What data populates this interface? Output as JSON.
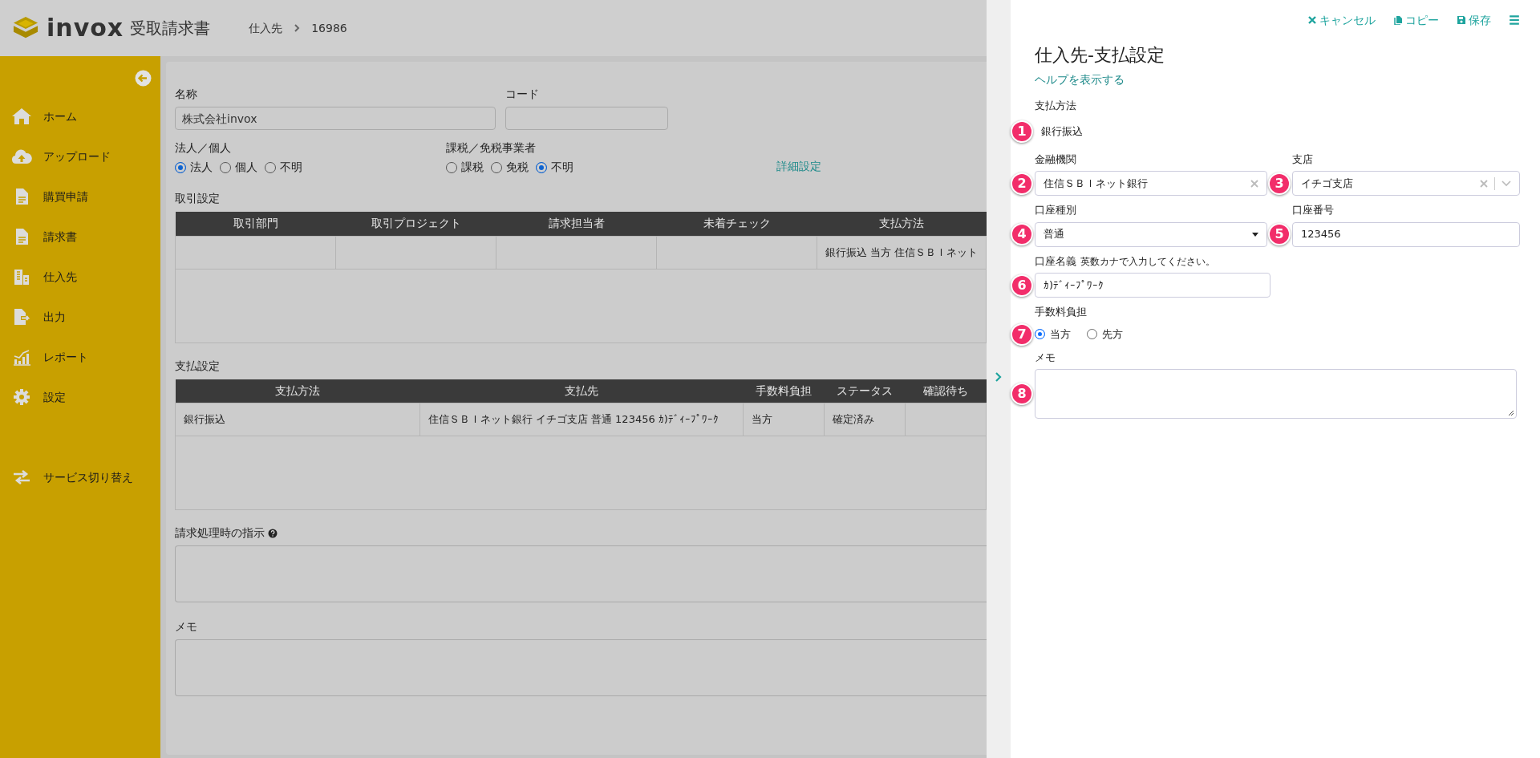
{
  "header": {
    "logo": "invox",
    "product": "受取請求書",
    "breadcrumb": [
      "仕入先",
      "16986"
    ]
  },
  "sidebar": {
    "items": [
      {
        "label": "ホーム",
        "kind": "home"
      },
      {
        "label": "アップロード",
        "kind": "upload"
      },
      {
        "label": "購買申請",
        "kind": "document"
      },
      {
        "label": "請求書",
        "kind": "document"
      },
      {
        "label": "仕入先",
        "kind": "building"
      },
      {
        "label": "出力",
        "kind": "export"
      },
      {
        "label": "レポート",
        "kind": "chart"
      },
      {
        "label": "設定",
        "kind": "gear"
      }
    ],
    "footer_items": [
      {
        "label": "サービス切り替え",
        "kind": "switch"
      }
    ]
  },
  "form": {
    "name": {
      "label": "名称",
      "value": "株式会社invox"
    },
    "code": {
      "label": "コード"
    },
    "entity": {
      "label": "法人／個人",
      "options": [
        {
          "label": "法人",
          "selected": true
        },
        {
          "label": "個人",
          "selected": false
        },
        {
          "label": "不明",
          "selected": false
        }
      ]
    },
    "tax": {
      "label": "課税／免税事業者",
      "options": [
        {
          "label": "課税",
          "selected": false
        },
        {
          "label": "免税",
          "selected": false
        },
        {
          "label": "不明",
          "selected": true
        }
      ]
    },
    "detail_link": "詳細設定",
    "trade_table": {
      "title": "取引設定",
      "columns": [
        "取引部門",
        "取引プロジェクト",
        "請求担当者",
        "未着チェック",
        "支払方法"
      ],
      "rows": [
        [
          "",
          "",
          "",
          "",
          "銀行振込 当方 住信ＳＢＩネット"
        ]
      ]
    },
    "payment_table": {
      "title": "支払設定",
      "columns": [
        "支払方法",
        "支払先",
        "手数料負担",
        "ステータス",
        "確認待ち"
      ],
      "rows": [
        [
          "銀行振込",
          "住信ＳＢＩネット銀行 イチゴ支店 普通 123456 ｶ)ﾃﾞｨｰﾌﾟﾜｰｸ",
          "当方",
          "確定済み",
          ""
        ]
      ]
    },
    "instructions": {
      "label": "請求処理時の指示"
    },
    "memo": {
      "label": "メモ"
    }
  },
  "panel": {
    "toolbar": [
      {
        "label": "キャンセル",
        "kind": "cancel"
      },
      {
        "label": "コピー",
        "kind": "copy"
      },
      {
        "label": "保存",
        "kind": "save"
      },
      {
        "kind": "menu"
      }
    ],
    "title": "仕入先-支払設定",
    "help_link": "ヘルプを表示する",
    "method": {
      "label": "支払方法",
      "value": "銀行振込",
      "marker": "1"
    },
    "bank": {
      "label": "金融機関",
      "value": "住信ＳＢＩネット銀行",
      "marker": "2"
    },
    "branch": {
      "label": "支店",
      "value": "イチゴ支店",
      "marker": "3"
    },
    "account_type": {
      "label": "口座種別",
      "value": "普通",
      "marker": "4"
    },
    "account_number": {
      "label": "口座番号",
      "value": "123456",
      "marker": "5"
    },
    "account_name": {
      "label": "口座名義",
      "hint": "英数カナで入力してください。",
      "value": "ｶ)ﾃﾞｨｰﾌﾟﾜｰｸ",
      "marker": "6"
    },
    "fee": {
      "label": "手数料負担",
      "options": [
        {
          "label": "当方",
          "selected": true
        },
        {
          "label": "先方",
          "selected": false
        }
      ],
      "marker": "7"
    },
    "memo": {
      "label": "メモ",
      "marker": "8"
    }
  }
}
